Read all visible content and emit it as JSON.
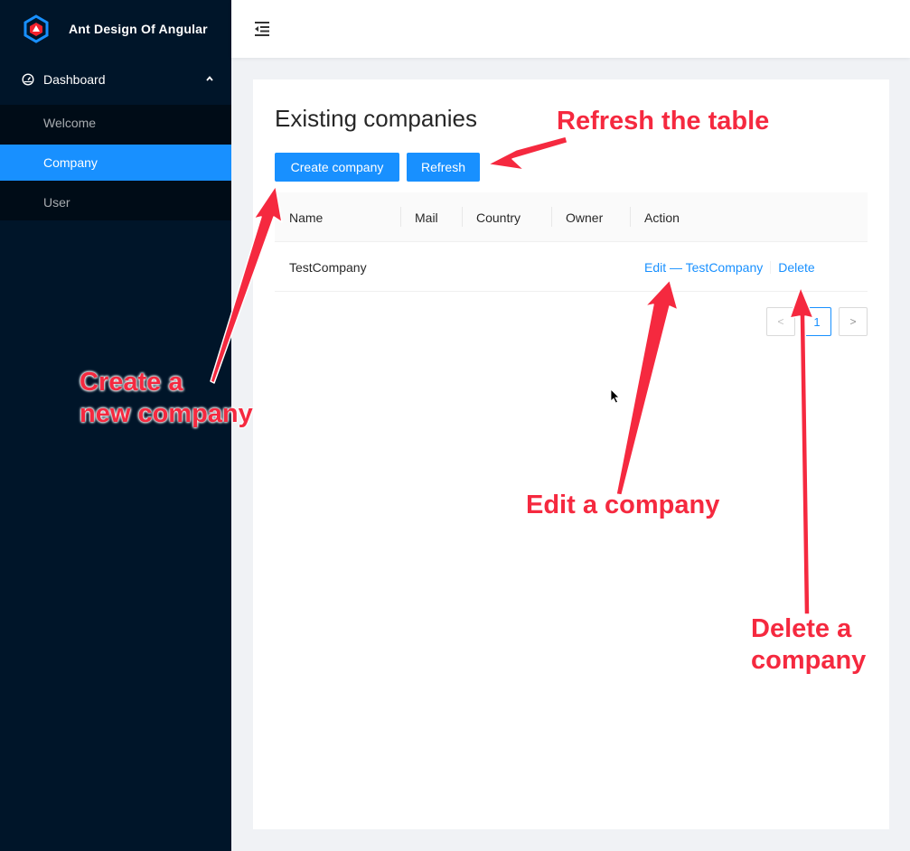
{
  "app": {
    "title": "Ant Design Of Angular",
    "logo_icon": "angular-hex-logo-icon"
  },
  "sidebar": {
    "submenu": {
      "label": "Dashboard",
      "icon": "dashboard-icon",
      "expand_icon": "chevron-up-icon"
    },
    "items": [
      {
        "label": "Welcome",
        "selected": false
      },
      {
        "label": "Company",
        "selected": true
      },
      {
        "label": "User",
        "selected": false
      }
    ]
  },
  "header": {
    "toggle_icon": "menu-fold-icon"
  },
  "page": {
    "title": "Existing companies",
    "buttons": {
      "create": "Create company",
      "refresh": "Refresh"
    }
  },
  "table": {
    "columns": [
      "Name",
      "Mail",
      "Country",
      "Owner",
      "Action"
    ],
    "rows": [
      {
        "name": "TestCompany",
        "mail": "",
        "country": "",
        "owner": "",
        "edit": "Edit — TestCompany",
        "delete": "Delete"
      }
    ]
  },
  "pagination": {
    "prev": "<",
    "current": "1",
    "next": ">"
  },
  "annotations": {
    "refresh": "Refresh the table",
    "create_1": "Create a",
    "create_2": "new company",
    "edit": "Edit a company",
    "delete_1": "Delete a",
    "delete_2": "company"
  },
  "colors": {
    "primary": "#1890ff",
    "sider": "#001529",
    "annotation": "#f5293f"
  }
}
